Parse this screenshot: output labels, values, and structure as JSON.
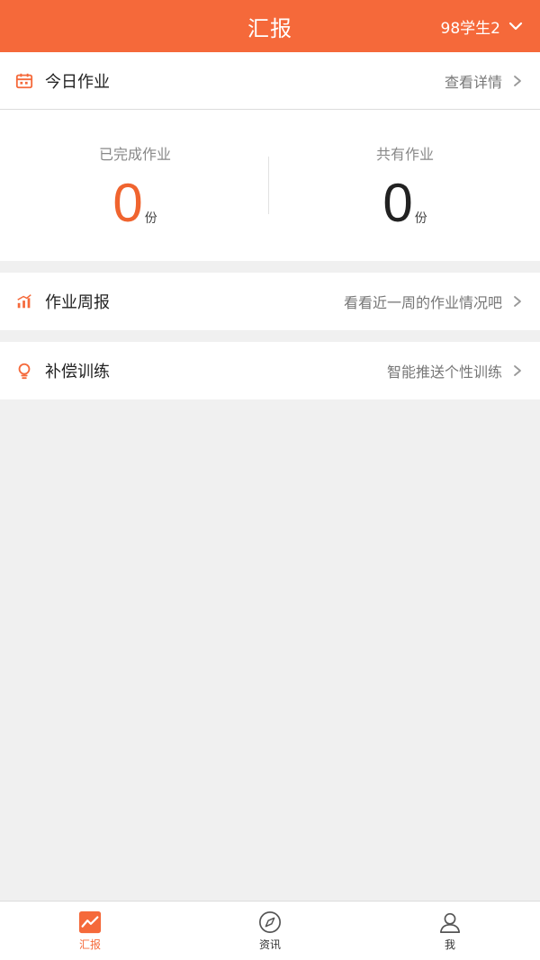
{
  "header": {
    "title": "汇报",
    "user_label": "98学生2"
  },
  "today": {
    "title": "今日作业",
    "link": "查看详情"
  },
  "stats": {
    "completed_label": "已完成作业",
    "completed_value": "0",
    "total_label": "共有作业",
    "total_value": "0",
    "unit": "份"
  },
  "weekly": {
    "title": "作业周报",
    "desc": "看看近一周的作业情况吧"
  },
  "compensation": {
    "title": "补偿训练",
    "desc": "智能推送个性训练"
  },
  "tabs": [
    {
      "label": "汇报",
      "icon": "report-icon",
      "active": true
    },
    {
      "label": "资讯",
      "icon": "compass-icon",
      "active": false
    },
    {
      "label": "我",
      "icon": "user-icon",
      "active": false
    }
  ],
  "colors": {
    "accent": "#f5693a",
    "completed_value": "#f0642f",
    "total_value": "#222222"
  }
}
